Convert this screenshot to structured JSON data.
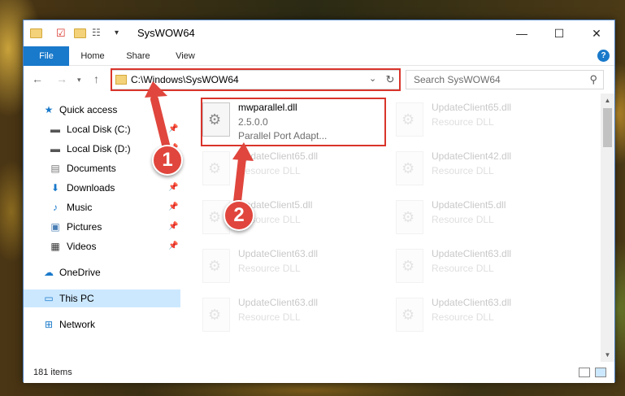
{
  "window": {
    "title": "SysWOW64",
    "controls": {
      "minimize": "—",
      "maximize": "☐",
      "close": "✕"
    }
  },
  "ribbon": {
    "tabs": [
      "File",
      "Home",
      "Share",
      "View"
    ],
    "help": "?"
  },
  "address": {
    "path": "C:\\Windows\\SysWOW64",
    "search_placeholder": "Search SysWOW64"
  },
  "sidebar": {
    "items": [
      {
        "label": "Quick access",
        "icon": "star-icon",
        "pinned": false
      },
      {
        "label": "Local Disk (C:)",
        "icon": "drive-icon",
        "pinned": true
      },
      {
        "label": "Local Disk (D:)",
        "icon": "drive-icon",
        "pinned": true
      },
      {
        "label": "Documents",
        "icon": "documents-icon",
        "pinned": true
      },
      {
        "label": "Downloads",
        "icon": "download-icon",
        "pinned": true
      },
      {
        "label": "Music",
        "icon": "music-icon",
        "pinned": true
      },
      {
        "label": "Pictures",
        "icon": "pictures-icon",
        "pinned": true
      },
      {
        "label": "Videos",
        "icon": "videos-icon",
        "pinned": true
      },
      {
        "label": "OneDrive",
        "icon": "cloud-icon",
        "pinned": false
      },
      {
        "label": "This PC",
        "icon": "computer-icon",
        "pinned": false,
        "selected": true
      },
      {
        "label": "Network",
        "icon": "network-icon",
        "pinned": false
      }
    ]
  },
  "files": {
    "highlighted": {
      "name": "mwparallel.dll",
      "version": "2.5.0.0",
      "description": "Parallel Port Adapt..."
    },
    "others": [
      {
        "name": "UpdateClient65.dll",
        "type": "Resource DLL"
      },
      {
        "name": "UpdateClient65.dll",
        "type": "Resource DLL"
      },
      {
        "name": "UpdateClient42.dll",
        "type": "Resource DLL"
      },
      {
        "name": "UpdateClient5.dll",
        "type": "Resource DLL"
      },
      {
        "name": "UpdateClient5.dll",
        "type": "Resource DLL"
      },
      {
        "name": "UpdateClient63.dll",
        "type": "Resource DLL"
      },
      {
        "name": "UpdateClient63.dll",
        "type": "Resource DLL"
      },
      {
        "name": "UpdateClient63.dll",
        "type": "Resource DLL"
      },
      {
        "name": "UpdateClient63.dll",
        "type": "Resource DLL"
      }
    ]
  },
  "status": {
    "item_count": "181 items"
  },
  "callouts": [
    "1",
    "2"
  ],
  "colors": {
    "accent": "#1979ca",
    "highlight": "#d9342b",
    "callout": "#e0463d",
    "selected": "#cce8ff"
  }
}
